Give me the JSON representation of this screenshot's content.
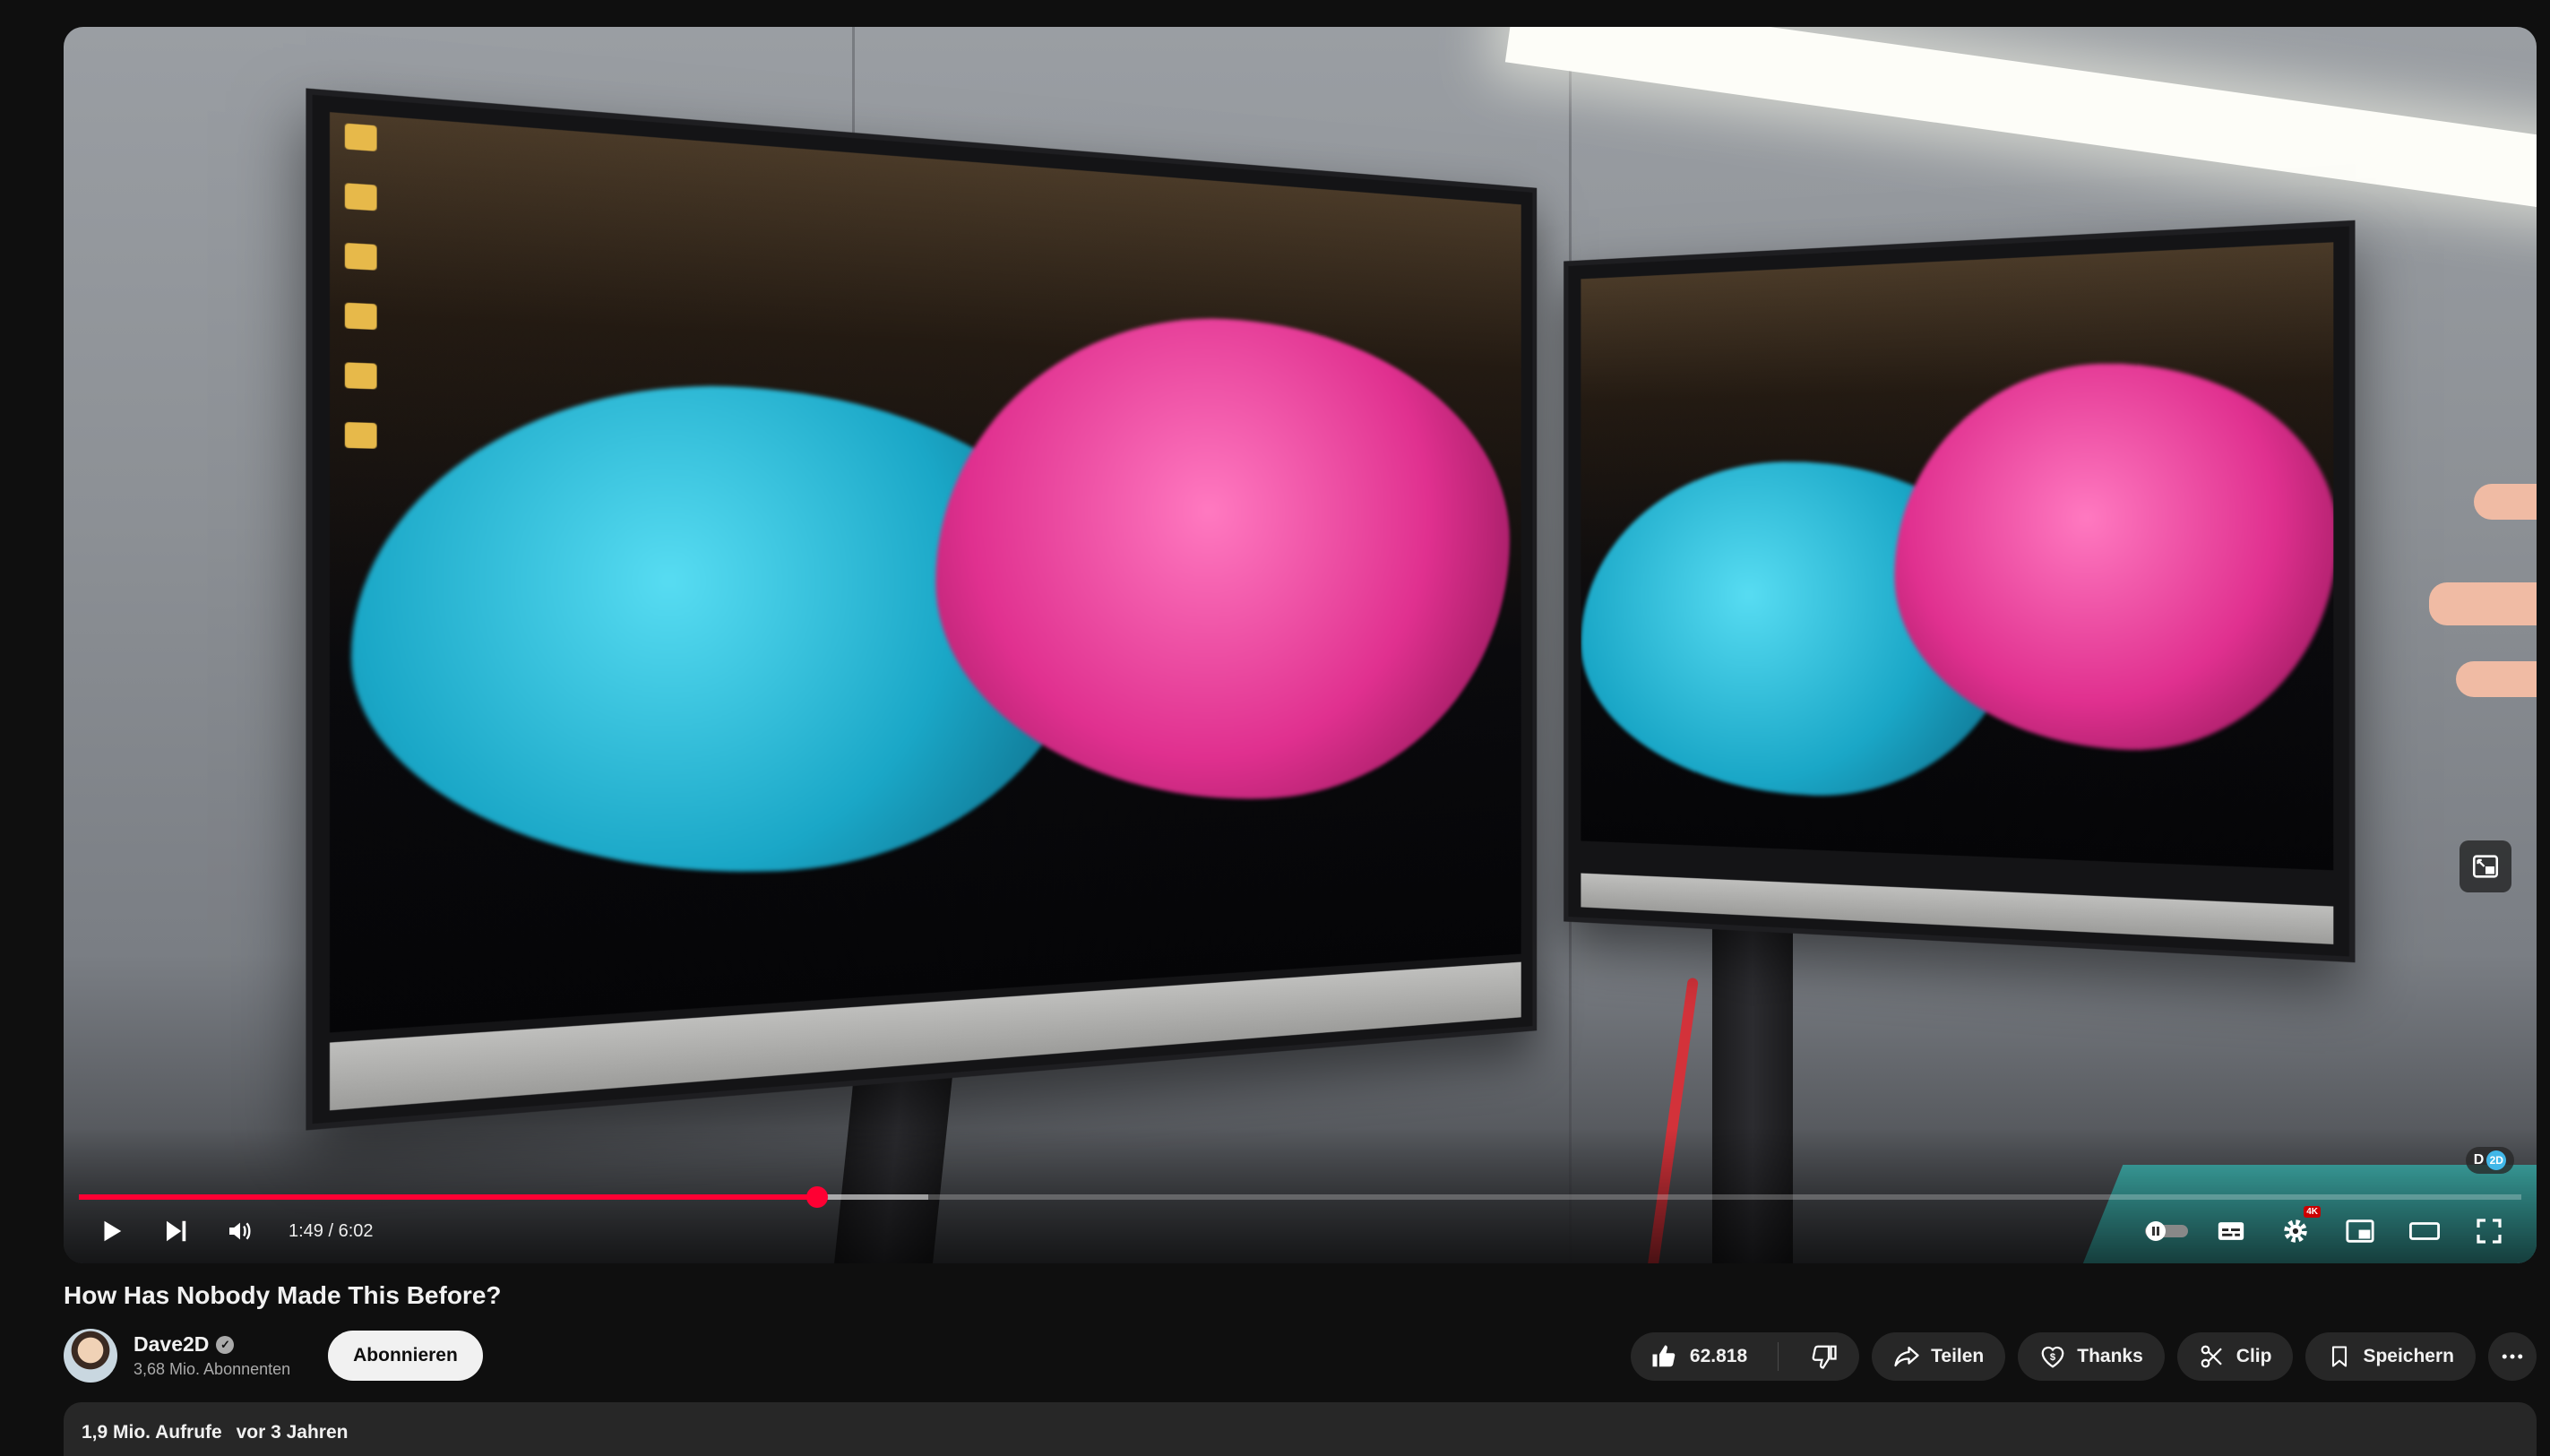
{
  "video": {
    "current_time": "1:49",
    "duration": "6:02",
    "time_display": "1:49 / 6:02",
    "progress_fraction": 0.3021,
    "buffered_fraction": 0.3479,
    "quality_badge": "4K",
    "channel_watermark": "2D",
    "accent_color": "#ff0033"
  },
  "title": "How Has Nobody Made This Before?",
  "channel": {
    "name": "Dave2D",
    "subscribers": "3,68 Mio. Abonnenten",
    "subscribe_label": "Abonnieren"
  },
  "actions": {
    "likes": "62.818",
    "share_label": "Teilen",
    "thanks_label": "Thanks",
    "clip_label": "Clip",
    "save_label": "Speichern"
  },
  "description": {
    "views": "1,9 Mio. Aufrufe",
    "age": "vor 3 Jahren"
  },
  "icons": [
    "play-icon",
    "next-icon",
    "volume-icon",
    "autoplay-toggle-icon",
    "subtitles-icon",
    "settings-icon",
    "miniplayer-icon",
    "theater-icon",
    "fullscreen-icon",
    "thumbs-up-icon",
    "thumbs-down-icon",
    "share-icon",
    "thanks-icon",
    "clip-icon",
    "bookmark-icon",
    "more-icon",
    "verified-icon",
    "pip-icon"
  ]
}
